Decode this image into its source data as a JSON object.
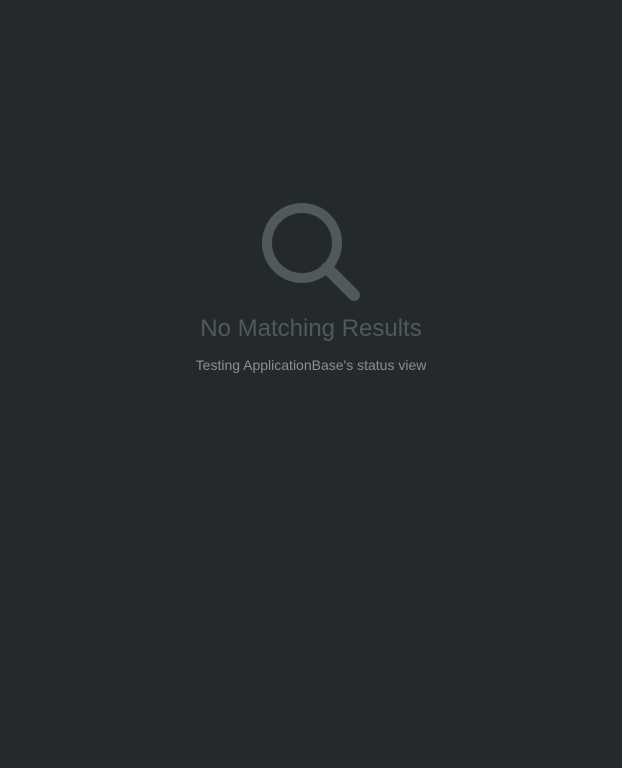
{
  "status_view": {
    "icon": "search-icon",
    "title": "No Matching Results",
    "description": "Testing ApplicationBase's status view",
    "colors": {
      "background": "#23292c",
      "icon": "#52595c",
      "title": "#52595c",
      "description": "#8a8f91"
    }
  }
}
